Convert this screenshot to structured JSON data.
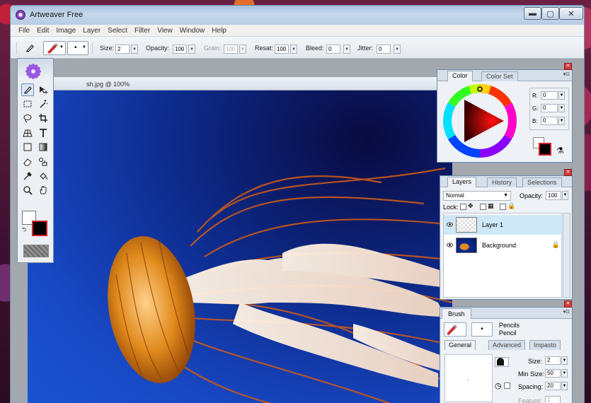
{
  "window": {
    "title": "Artweaver Free"
  },
  "menu": [
    "File",
    "Edit",
    "Image",
    "Layer",
    "Select",
    "Filter",
    "View",
    "Window",
    "Help"
  ],
  "options": {
    "size_label": "Size:",
    "size_value": "2",
    "opacity_label": "Opacity:",
    "opacity_value": "100",
    "grain_label": "Grain:",
    "grain_value": "100",
    "resat_label": "Resat:",
    "resat_value": "100",
    "bleed_label": "Bleed:",
    "bleed_value": "0",
    "jitter_label": "Jitter:",
    "jitter_value": "0"
  },
  "document": {
    "title": "sh.jpg @ 100%"
  },
  "color_panel": {
    "tabs": [
      "Color",
      "Color Set"
    ],
    "r_label": "R:",
    "g_label": "G:",
    "b_label": "B:",
    "r": "0",
    "g": "0",
    "b": "0",
    "foreground": "#000000",
    "background": "#ffffff"
  },
  "layers_panel": {
    "tabs": [
      "Layers",
      "History",
      "Selections"
    ],
    "blend_mode": "Normal",
    "opacity_label": "Opacity:",
    "opacity": "100",
    "lock_label": "Lock:",
    "layers": [
      {
        "name": "Layer 1"
      },
      {
        "name": "Background"
      }
    ]
  },
  "brush_panel": {
    "title": "Brush",
    "category": "Pencils",
    "variant": "Pencil",
    "tabs": [
      "General",
      "Advanced",
      "Impasto"
    ],
    "size_label": "Size:",
    "size": "2",
    "min_size_label": "Min Size:",
    "min_size": "50",
    "spacing_label": "Spacing:",
    "spacing": "20",
    "feature_label": "Feature:",
    "feature": "1"
  },
  "colors": {
    "accent": "#6f8aa8",
    "foreground_border": "#d21f25"
  }
}
